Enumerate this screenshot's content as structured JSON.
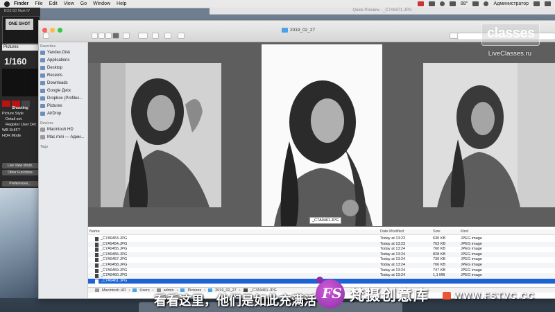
{
  "menubar": {
    "items": [
      "Finder",
      "File",
      "Edit",
      "View",
      "Go",
      "Window",
      "Help"
    ],
    "battery": "88°",
    "user": "Администратор"
  },
  "left_panel": {
    "title": "EOS 5D Mark IV",
    "lcd": "ONE SHOT",
    "folder": "Pictures",
    "shutter": "1/160",
    "section": "Shooting",
    "picture_style": "Picture Style",
    "detail": "Detail set.",
    "register": "Register User Def.",
    "wb_shift": "WB SHIFT",
    "hdr_mode": "HDR Mode",
    "live_view": "Live View shoot.",
    "other": "Other Functions",
    "preferences": "Preferences..."
  },
  "finder": {
    "quick_preview_title": "Quick Preview - _C7A9471.JPG",
    "path_title": "2019_02_27",
    "sidebar": {
      "favorites_label": "Favorites",
      "favorites": [
        {
          "label": "Yandex.Disk",
          "icon": "cloud-icon"
        },
        {
          "label": "Applications",
          "icon": "applications-icon"
        },
        {
          "label": "Desktop",
          "icon": "desktop-icon"
        },
        {
          "label": "Recents",
          "icon": "clock-icon"
        },
        {
          "label": "Downloads",
          "icon": "download-icon"
        },
        {
          "label": "Google Диск",
          "icon": "drive-icon"
        },
        {
          "label": "Dropbox (Profiles...",
          "icon": "dropbox-icon"
        },
        {
          "label": "Pictures",
          "icon": "pictures-icon"
        },
        {
          "label": "AirDrop",
          "icon": "airdrop-icon"
        }
      ],
      "devices_label": "Devices",
      "devices": [
        {
          "label": "Macintosh HD",
          "icon": "disk-icon"
        },
        {
          "label": "Mac mini — Адми...",
          "icon": "computer-icon"
        }
      ],
      "tags_label": "Tags"
    },
    "preview_label": "_C7A9461.JPG",
    "list": {
      "headers": {
        "name": "Name",
        "date": "Date Modified",
        "size": "Size",
        "kind": "Kind"
      },
      "rows": [
        {
          "name": "_C7A9453.JPG",
          "date": "Today at 13:23",
          "size": "630 KB",
          "kind": "JPEG image"
        },
        {
          "name": "_C7A9454.JPG",
          "date": "Today at 13:23",
          "size": "703 KB",
          "kind": "JPEG image"
        },
        {
          "name": "_C7A9455.JPG",
          "date": "Today at 13:24",
          "size": "760 KB",
          "kind": "JPEG image"
        },
        {
          "name": "_C7A9456.JPG",
          "date": "Today at 13:24",
          "size": "828 KB",
          "kind": "JPEG image"
        },
        {
          "name": "_C7A9457.JPG",
          "date": "Today at 13:24",
          "size": "730 KB",
          "kind": "JPEG image"
        },
        {
          "name": "_C7A9458.JPG",
          "date": "Today at 13:24",
          "size": "706 KB",
          "kind": "JPEG image"
        },
        {
          "name": "_C7A9459.JPG",
          "date": "Today at 13:24",
          "size": "747 KB",
          "kind": "JPEG image"
        },
        {
          "name": "_C7A9460.JPG",
          "date": "Today at 13:24",
          "size": "1,1 MB",
          "kind": "JPEG image"
        },
        {
          "name": "_C7A9461.JPG",
          "date": "",
          "size": "",
          "kind": ""
        }
      ]
    },
    "pathbar": [
      "Macintosh HD",
      "Users",
      "admin",
      "Pictures",
      "2019_02_27",
      "_C7A9461.JPG"
    ]
  },
  "watermark": {
    "logo": "classes",
    "site": "LiveClasses.ru"
  },
  "subtitle": "看看这里，他们是如此充满活",
  "brand": {
    "logo": "FS",
    "name": "梵摄创意库",
    "url": "WWW.FSTVC.CC"
  }
}
